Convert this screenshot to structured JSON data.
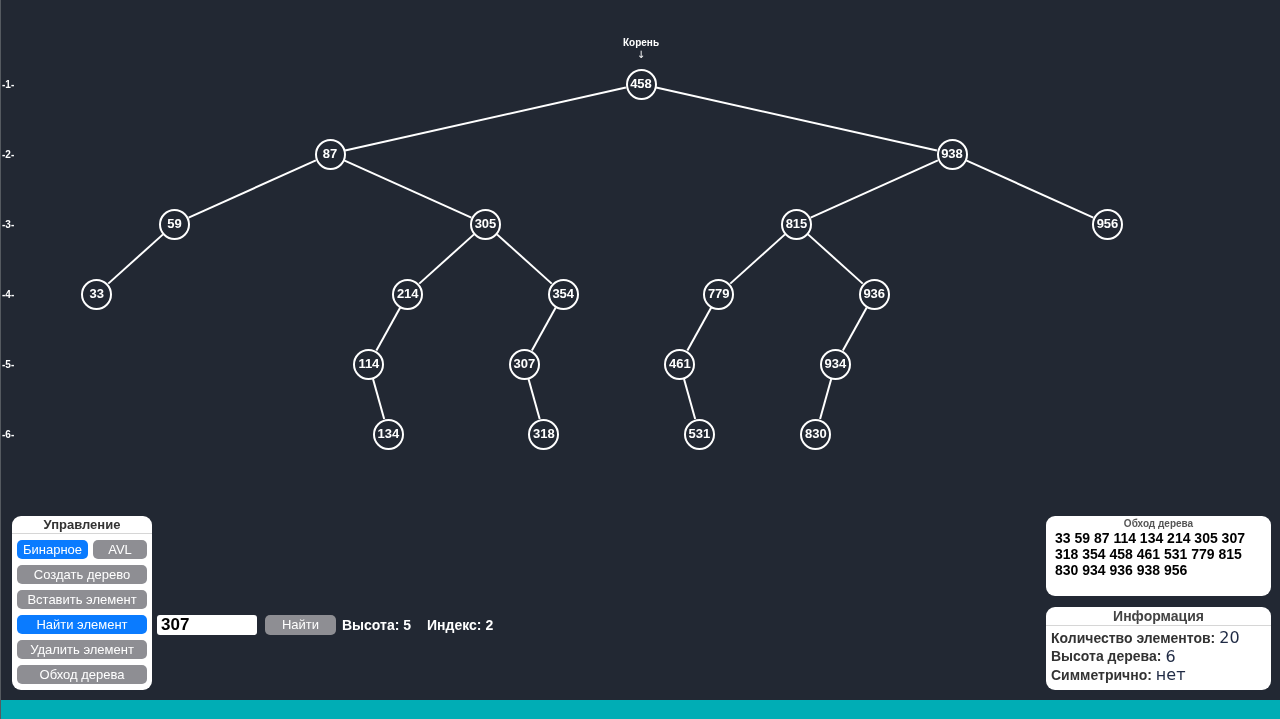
{
  "tree": {
    "root_label": "Корень",
    "root_arrow": "↓",
    "level_labels": [
      "-1-",
      "-2-",
      "-3-",
      "-4-",
      "-5-",
      "-6-"
    ],
    "root": {
      "value": "458",
      "children": [
        {
          "kind": "left",
          "value": "87",
          "children": [
            {
              "kind": "left",
              "value": "59",
              "children": [
                {
                  "kind": "left",
                  "value": "33"
                }
              ]
            },
            {
              "kind": "right",
              "value": "305",
              "children": [
                {
                  "kind": "left",
                  "value": "214",
                  "children": [
                    {
                      "kind": "left",
                      "value": "114",
                      "children": [
                        {
                          "kind": "right",
                          "value": "134"
                        }
                      ]
                    }
                  ]
                },
                {
                  "kind": "right",
                  "value": "354",
                  "children": [
                    {
                      "kind": "left",
                      "value": "307",
                      "children": [
                        {
                          "kind": "right",
                          "value": "318"
                        }
                      ]
                    }
                  ]
                }
              ]
            }
          ]
        },
        {
          "kind": "right",
          "value": "938",
          "children": [
            {
              "kind": "left",
              "value": "815",
              "children": [
                {
                  "kind": "left",
                  "value": "779",
                  "children": [
                    {
                      "kind": "left",
                      "value": "461",
                      "children": [
                        {
                          "kind": "right",
                          "value": "531"
                        }
                      ]
                    }
                  ]
                },
                {
                  "kind": "right",
                  "value": "936",
                  "children": [
                    {
                      "kind": "left",
                      "value": "934",
                      "children": [
                        {
                          "kind": "left",
                          "value": "830"
                        }
                      ]
                    }
                  ]
                }
              ]
            },
            {
              "kind": "right",
              "value": "956"
            }
          ]
        }
      ]
    }
  },
  "control_panel": {
    "title": "Управление",
    "tree_types": [
      {
        "label": "Бинарное",
        "selected": true
      },
      {
        "label": "AVL",
        "selected": false
      }
    ],
    "actions": [
      {
        "label": "Создать дерево",
        "selected": false
      },
      {
        "label": "Вставить элемент",
        "selected": false
      },
      {
        "label": "Найти элемент",
        "selected": true
      },
      {
        "label": "Удалить элемент",
        "selected": false
      },
      {
        "label": "Обход дерева",
        "selected": false
      }
    ]
  },
  "search": {
    "value": "307",
    "button": "Найти",
    "height": "Высота: 5",
    "index": "Индекс: 2"
  },
  "traversal": {
    "title": "Обход дерева",
    "text": "33 59 87 114 134 214 305 307 318 354 458 461 531 779 815 830 934 936 938 956"
  },
  "info": {
    "title": "Информация",
    "rows": [
      {
        "label": "Количество элементов:",
        "value": "20"
      },
      {
        "label": "Высота дерева:",
        "value": "6"
      },
      {
        "label": "Симметрично:",
        "value": "нет"
      }
    ]
  }
}
